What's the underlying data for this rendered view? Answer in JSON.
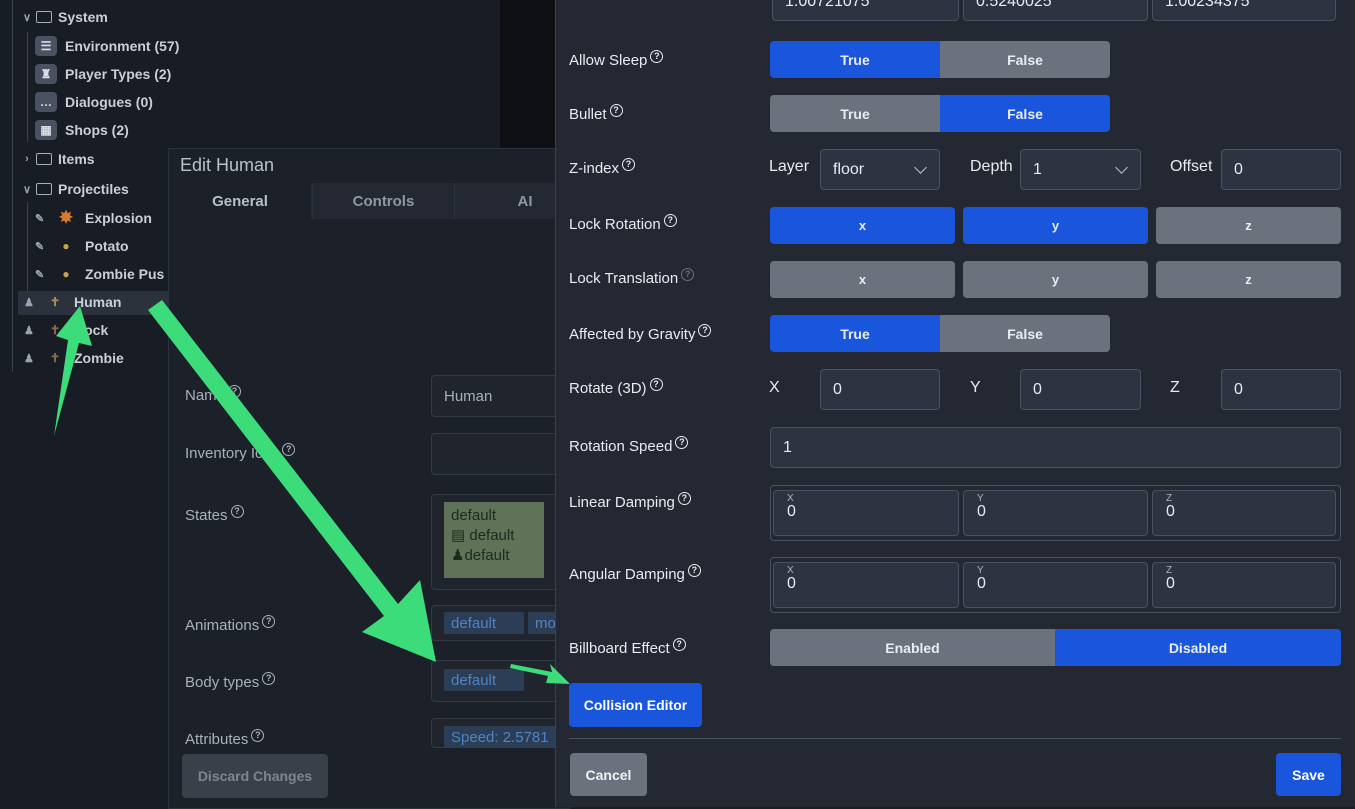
{
  "sidebar": {
    "system": "System",
    "environment": "Environment (57)",
    "player_types": "Player Types (2)",
    "dialogues": "Dialogues (0)",
    "shops": "Shops (2)",
    "items": "Items",
    "projectiles": "Projectiles",
    "explosion": "Explosion",
    "potato": "Potato",
    "zombie_pus": "Zombie Pus",
    "human": "Human",
    "rock": "Rock",
    "zombie": "Zombie"
  },
  "edit_panel": {
    "title": "Edit Human",
    "tabs": [
      "General",
      "Controls",
      "AI"
    ],
    "name_label": "Name",
    "name_value": "Human",
    "inventory_label": "Inventory Icon",
    "states_label": "States",
    "states": [
      "default",
      "default",
      "default"
    ],
    "animations_label": "Animations",
    "animations": [
      "default",
      "mo"
    ],
    "body_types_label": "Body types",
    "body_types": [
      "default"
    ],
    "attributes_label": "Attributes",
    "attributes": [
      "Speed: 2.5781"
    ],
    "discard_button": "Discard Changes"
  },
  "modal": {
    "top_values": [
      "1.00721075",
      "0.5240025",
      "1.00234375"
    ],
    "allow_sleep": {
      "label": "Allow Sleep",
      "true": "True",
      "false": "False",
      "selected": "True"
    },
    "bullet": {
      "label": "Bullet",
      "true": "True",
      "false": "False",
      "selected": "False"
    },
    "z_index": {
      "label": "Z-index",
      "layer_label": "Layer",
      "layer_value": "floor",
      "depth_label": "Depth",
      "depth_value": "1",
      "offset_label": "Offset",
      "offset_value": "0"
    },
    "lock_rotation": {
      "label": "Lock Rotation",
      "x": "x",
      "y": "y",
      "z": "z"
    },
    "lock_translation": {
      "label": "Lock Translation",
      "x": "x",
      "y": "y",
      "z": "z"
    },
    "gravity": {
      "label": "Affected by Gravity",
      "true": "True",
      "false": "False",
      "selected": "True"
    },
    "rotate3d": {
      "label": "Rotate (3D)",
      "x_label": "X",
      "x": "0",
      "y_label": "Y",
      "y": "0",
      "z_label": "Z",
      "z": "0"
    },
    "rotation_speed": {
      "label": "Rotation Speed",
      "value": "1"
    },
    "linear_damping": {
      "label": "Linear Damping",
      "x_label": "X",
      "x": "0",
      "y_label": "Y",
      "y": "0",
      "z_label": "Z",
      "z": "0"
    },
    "angular_damping": {
      "label": "Angular Damping",
      "x_label": "X",
      "x": "0",
      "y_label": "Y",
      "y": "0",
      "z_label": "Z",
      "z": "0"
    },
    "billboard": {
      "label": "Billboard Effect",
      "enabled": "Enabled",
      "disabled": "Disabled",
      "selected": "Disabled"
    },
    "collision_editor": "Collision Editor",
    "cancel": "Cancel",
    "save": "Save"
  },
  "colors": {
    "accent": "#1a56db",
    "arrow": "#3ddc7a",
    "off": "#6b727e"
  }
}
